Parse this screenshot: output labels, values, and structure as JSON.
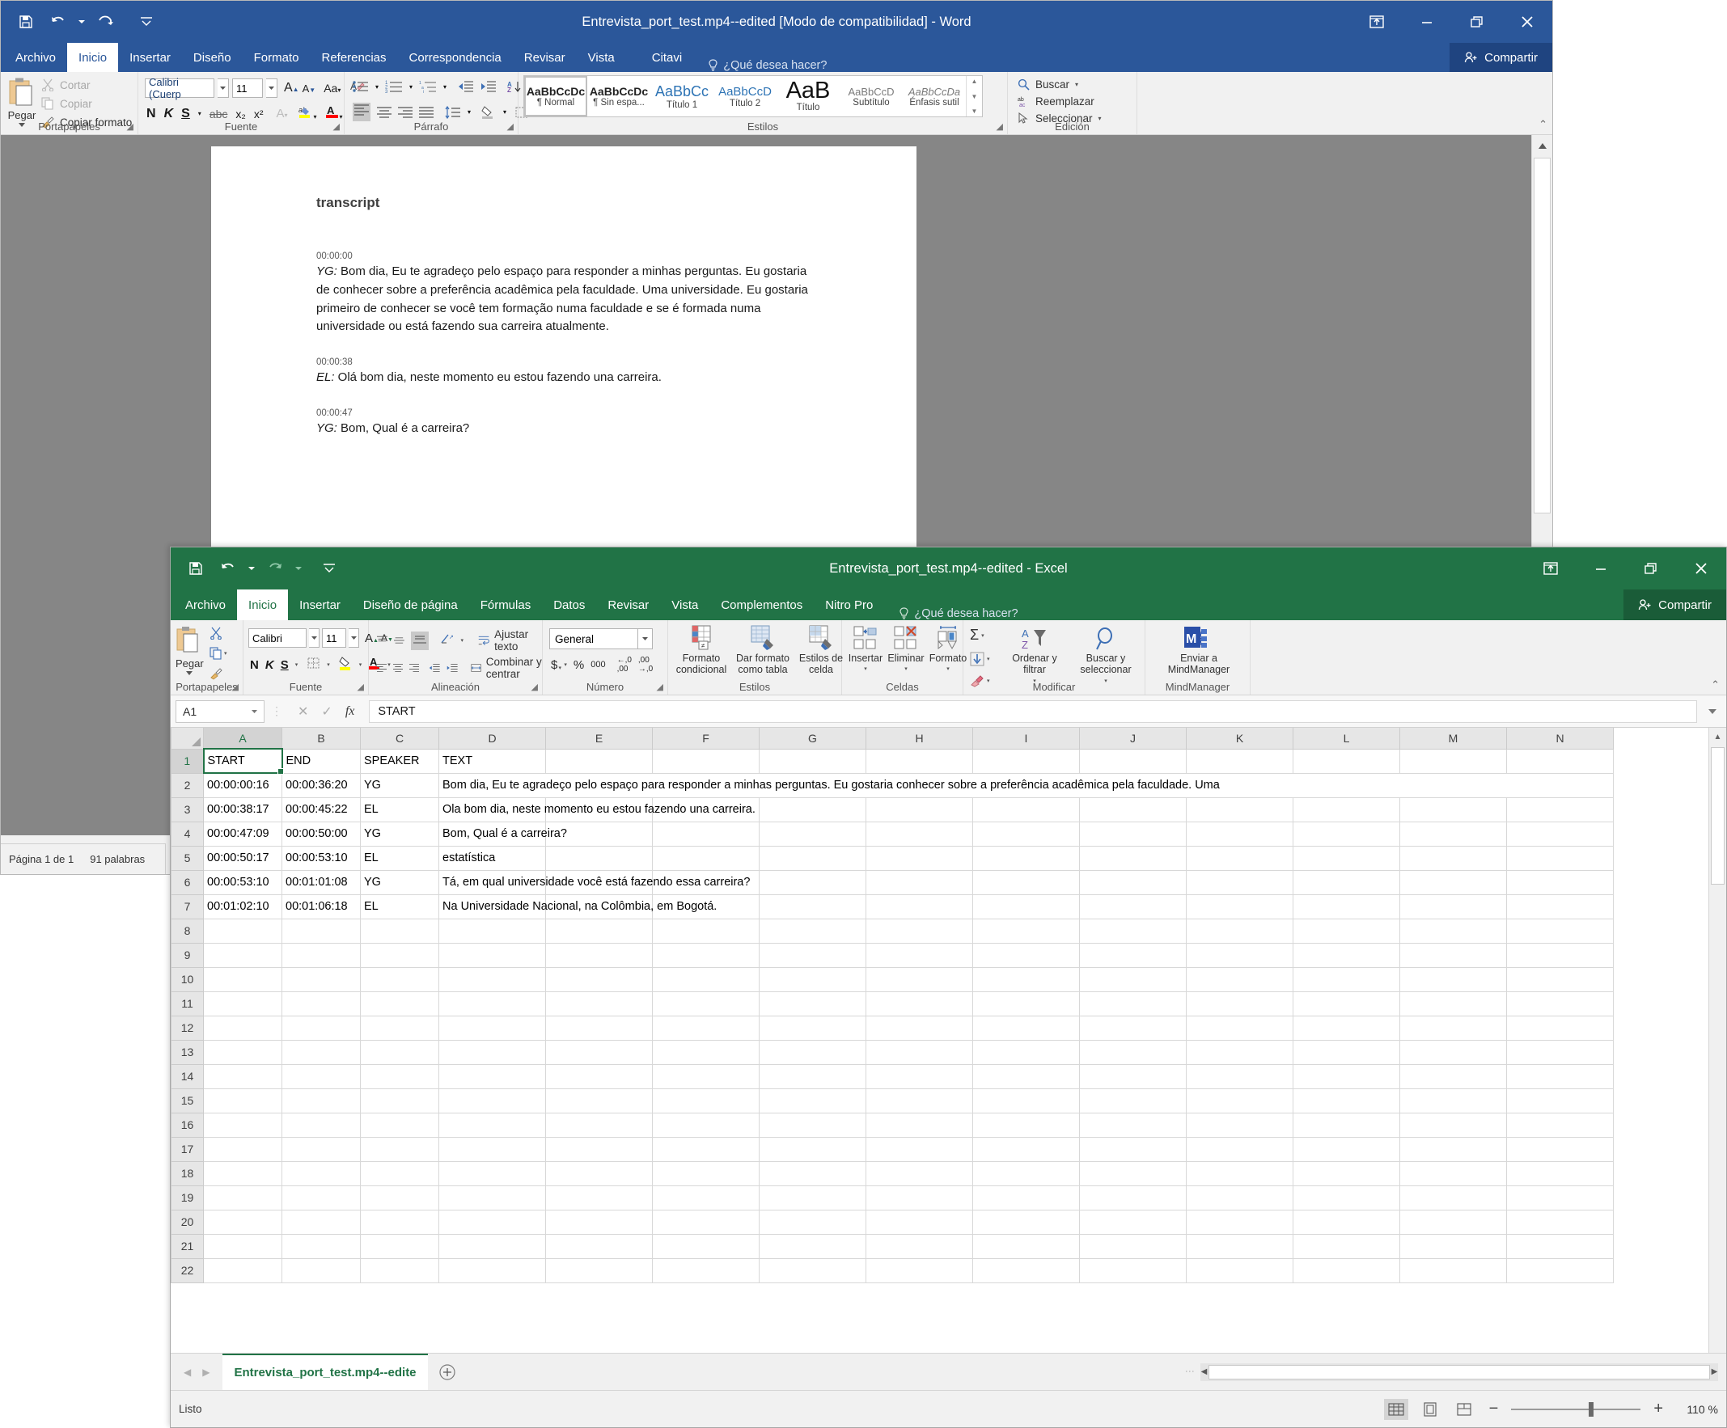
{
  "word": {
    "title": "Entrevista_port_test.mp4--edited [Modo de compatibilidad] - Word",
    "qat": {
      "save": "save-icon",
      "undo": "undo-icon",
      "redo": "redo-icon",
      "more": "customize-icon"
    },
    "window_controls": {
      "ribbon_options": "ribbon-display-icon",
      "minimize": "–",
      "restore": "restore-icon",
      "close": "✕"
    },
    "tabs": [
      {
        "label": "Archivo",
        "active": false
      },
      {
        "label": "Inicio",
        "active": true
      },
      {
        "label": "Insertar",
        "active": false
      },
      {
        "label": "Diseño",
        "active": false
      },
      {
        "label": "Formato",
        "active": false
      },
      {
        "label": "Referencias",
        "active": false
      },
      {
        "label": "Correspondencia",
        "active": false
      },
      {
        "label": "Revisar",
        "active": false
      },
      {
        "label": "Vista",
        "active": false
      },
      {
        "label": "Citavi",
        "active": false
      }
    ],
    "tell_me": "¿Qué desea hacer?",
    "share": "Compartir",
    "ribbon": {
      "clipboard": {
        "group": "Portapapeles",
        "paste": "Pegar",
        "cut": "Cortar",
        "copy": "Copiar",
        "format_painter": "Copiar formato"
      },
      "font": {
        "group": "Fuente",
        "font_name": "Calibri (Cuerp",
        "font_size": "11",
        "bold": "N",
        "italic": "K",
        "underline": "S",
        "strikethrough": "abc",
        "subscript": "x₂",
        "superscript": "x²",
        "change_case": "Aa"
      },
      "paragraph": {
        "group": "Párrafo"
      },
      "styles": {
        "group": "Estilos",
        "items": [
          {
            "preview": "AaBbCcDc",
            "name": "¶ Normal"
          },
          {
            "preview": "AaBbCcDc",
            "name": "¶ Sin espa..."
          },
          {
            "preview": "AaBbCc",
            "name": "Título 1"
          },
          {
            "preview": "AaBbCcD",
            "name": "Título 2"
          },
          {
            "preview": "AaB",
            "name": "Título"
          },
          {
            "preview": "AaBbCcD",
            "name": "Subtítulo"
          },
          {
            "preview": "AaBbCcDa",
            "name": "Énfasis sutil"
          }
        ]
      },
      "editing": {
        "group": "Edición",
        "find": "Buscar",
        "replace": "Reemplazar",
        "select": "Seleccionar"
      }
    },
    "document": {
      "heading": "transcript",
      "blocks": [
        {
          "time": "00:00:00",
          "speaker": "YG:",
          "text": " Bom dia, Eu te agradeço pelo espaço para responder a minhas perguntas. Eu gostaria de conhecer sobre a preferência acadêmica pela faculdade. Uma universidade. Eu gostaria primeiro de conhecer se você tem formação numa faculdade e se é formada numa universidade ou está fazendo sua carreira atualmente."
        },
        {
          "time": "00:00:38",
          "speaker": "EL:",
          "text": " Olá bom dia, neste momento eu estou fazendo una carreira."
        },
        {
          "time": "00:00:47",
          "speaker": "YG:",
          "text": " Bom, Qual é a carreira?"
        }
      ]
    },
    "status": {
      "page": "Página 1 de 1",
      "words": "91 palabras"
    }
  },
  "excel": {
    "title": "Entrevista_port_test.mp4--edited - Excel",
    "window_controls": {
      "ribbon_options": "ribbon-display-icon",
      "minimize": "–",
      "restore": "restore-icon",
      "close": "✕"
    },
    "tabs": [
      {
        "label": "Archivo",
        "active": false
      },
      {
        "label": "Inicio",
        "active": true
      },
      {
        "label": "Insertar",
        "active": false
      },
      {
        "label": "Diseño de página",
        "active": false
      },
      {
        "label": "Fórmulas",
        "active": false
      },
      {
        "label": "Datos",
        "active": false
      },
      {
        "label": "Revisar",
        "active": false
      },
      {
        "label": "Vista",
        "active": false
      },
      {
        "label": "Complementos",
        "active": false
      },
      {
        "label": "Nitro Pro",
        "active": false
      }
    ],
    "tell_me": "¿Qué desea hacer?",
    "share": "Compartir",
    "ribbon": {
      "clipboard": {
        "group": "Portapapeles",
        "paste": "Pegar"
      },
      "font": {
        "group": "Fuente",
        "font_name": "Calibri",
        "font_size": "11",
        "bold": "N",
        "italic": "K",
        "underline": "S"
      },
      "alignment": {
        "group": "Alineación",
        "wrap_text": "Ajustar texto",
        "merge_center": "Combinar y centrar"
      },
      "number": {
        "group": "Número",
        "format": "General"
      },
      "styles": {
        "group": "Estilos",
        "conditional": "Formato condicional",
        "as_table": "Dar formato como tabla",
        "cell_styles": "Estilos de celda"
      },
      "cells": {
        "group": "Celdas",
        "insert": "Insertar",
        "delete": "Eliminar",
        "format": "Formato"
      },
      "editing": {
        "group": "Modificar",
        "sort_filter": "Ordenar y filtrar",
        "find_select": "Buscar y seleccionar"
      },
      "mindmanager": {
        "group": "MindManager",
        "send": "Enviar a MindManager"
      }
    },
    "formula_bar": {
      "name_box": "A1",
      "cancel": "✕",
      "enter": "✓",
      "insert_function": "fx",
      "value": "START"
    },
    "grid": {
      "columns": [
        "A",
        "B",
        "C",
        "D",
        "E",
        "F",
        "G",
        "H",
        "I",
        "J",
        "K",
        "L",
        "M",
        "N"
      ],
      "selected_column": "A",
      "selected_row": 1,
      "rows": [
        {
          "n": 1,
          "cells": [
            "START",
            "END",
            "SPEAKER",
            "TEXT"
          ]
        },
        {
          "n": 2,
          "cells": [
            "00:00:00:16",
            "00:00:36:20",
            "YG",
            "Bom dia, Eu te agradeço pelo espaço para responder a minhas perguntas. Eu gostaria conhecer sobre a preferência acadêmica pela faculdade. Uma"
          ]
        },
        {
          "n": 3,
          "cells": [
            "00:00:38:17",
            "00:00:45:22",
            "EL",
            "Ola bom dia, neste momento eu estou fazendo una carreira."
          ]
        },
        {
          "n": 4,
          "cells": [
            "00:00:47:09",
            "00:00:50:00",
            "YG",
            "Bom, Qual é a carreira?"
          ]
        },
        {
          "n": 5,
          "cells": [
            "00:00:50:17",
            "00:00:53:10",
            "EL",
            "estatística"
          ]
        },
        {
          "n": 6,
          "cells": [
            "00:00:53:10",
            "00:01:01:08",
            "YG",
            "Tá, em qual universidade você está fazendo essa carreira?"
          ]
        },
        {
          "n": 7,
          "cells": [
            "00:01:02:10",
            "00:01:06:18",
            "EL",
            "Na Universidade Nacional, na Colômbia, em Bogotá."
          ]
        },
        {
          "n": 8,
          "cells": [
            "",
            "",
            "",
            ""
          ]
        },
        {
          "n": 9,
          "cells": [
            "",
            "",
            "",
            ""
          ]
        },
        {
          "n": 10,
          "cells": [
            "",
            "",
            "",
            ""
          ]
        },
        {
          "n": 11,
          "cells": [
            "",
            "",
            "",
            ""
          ]
        },
        {
          "n": 12,
          "cells": [
            "",
            "",
            "",
            ""
          ]
        },
        {
          "n": 13,
          "cells": [
            "",
            "",
            "",
            ""
          ]
        },
        {
          "n": 14,
          "cells": [
            "",
            "",
            "",
            ""
          ]
        },
        {
          "n": 15,
          "cells": [
            "",
            "",
            "",
            ""
          ]
        },
        {
          "n": 16,
          "cells": [
            "",
            "",
            "",
            ""
          ]
        },
        {
          "n": 17,
          "cells": [
            "",
            "",
            "",
            ""
          ]
        },
        {
          "n": 18,
          "cells": [
            "",
            "",
            "",
            ""
          ]
        },
        {
          "n": 19,
          "cells": [
            "",
            "",
            "",
            ""
          ]
        },
        {
          "n": 20,
          "cells": [
            "",
            "",
            "",
            ""
          ]
        },
        {
          "n": 21,
          "cells": [
            "",
            "",
            "",
            ""
          ]
        },
        {
          "n": 22,
          "cells": [
            "",
            "",
            "",
            ""
          ]
        }
      ]
    },
    "sheet_tabs": {
      "active": "Entrevista_port_test.mp4--edite",
      "add": "+"
    },
    "status": {
      "state": "Listo",
      "zoom": "110 %"
    }
  },
  "colors": {
    "word_accent": "#2b579a",
    "excel_accent": "#217346",
    "ribbon_bg": "#f1f1f1",
    "grid_line": "#d8d8d8"
  }
}
